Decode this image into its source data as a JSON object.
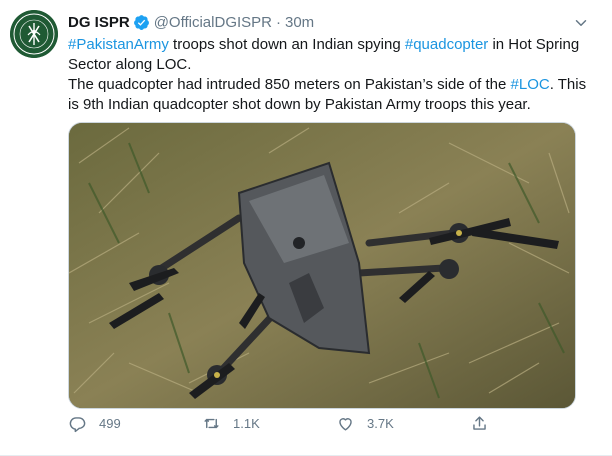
{
  "account": {
    "name": "DG ISPR",
    "handle": "@OfficialDGISPR",
    "separator": "·",
    "time": "30m",
    "avatar_text": "INTER SERVICES PUBLIC RELATIONS · ISPR"
  },
  "tweet": {
    "segments": [
      {
        "t": "#PakistanArmy",
        "link": true
      },
      {
        "t": " troops shot down an Indian spying ",
        "link": false
      },
      {
        "t": "#quadcopter",
        "link": true
      },
      {
        "t": " in Hot Spring Sector along LOC.",
        "link": false
      },
      {
        "t": "\n",
        "link": false
      },
      {
        "t": "The quadcopter had intruded 850 meters on Pakistan’s side of the ",
        "link": false
      },
      {
        "t": "#LOC",
        "link": true
      },
      {
        "t": ". This is 9th Indian quadcopter shot down by Pakistan Army troops this year.",
        "link": false
      }
    ]
  },
  "actions": {
    "reply_count": "499",
    "retweet_count": "1.1K",
    "like_count": "3.7K"
  },
  "icons": {
    "verified": "verified-badge-icon",
    "caret": "chevron-down-icon",
    "reply": "reply-icon",
    "retweet": "retweet-icon",
    "like": "like-icon",
    "share": "share-icon"
  },
  "colors": {
    "link": "#1b95e0",
    "secondary_text": "#657786",
    "verified": "#1da1f2",
    "avatar_bg": "#1f5a34"
  }
}
